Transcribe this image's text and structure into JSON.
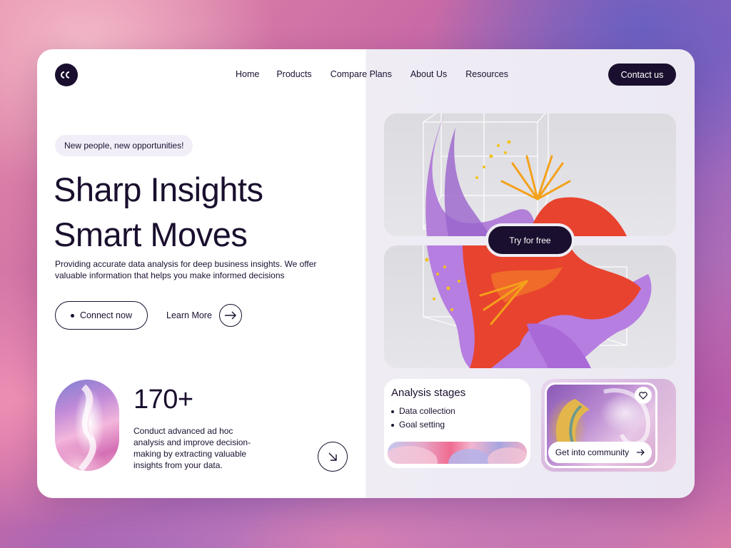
{
  "nav": {
    "logo_icon": "cc-logo-icon",
    "links": [
      "Home",
      "Products",
      "Compare Plans",
      "About Us",
      "Resources"
    ],
    "contact_label": "Contact us"
  },
  "hero": {
    "pill": "New people, new opportunities!",
    "headline_line1": "Sharp Insights",
    "headline_line2": "Smart Moves",
    "description": "Providing accurate data analysis for deep business insights. We offer valuable information that helps you make informed decisions",
    "connect_label": "Connect now",
    "learn_more_label": "Learn More"
  },
  "stat": {
    "value": "170+",
    "description": "Conduct advanced ad hoc analysis and improve decision-making by extracting valuable insights from your data."
  },
  "showcase": {
    "try_label": "Try for free"
  },
  "stages": {
    "title": "Analysis stages",
    "items": [
      "Data collection",
      "Goal setting"
    ]
  },
  "community": {
    "label": "Get into community",
    "heart_icon": "heart-icon"
  },
  "colors": {
    "dark": "#1a0f2e",
    "accent_purple": "#a66bd6",
    "accent_orange": "#f2a21a",
    "accent_red": "#e8422e"
  }
}
